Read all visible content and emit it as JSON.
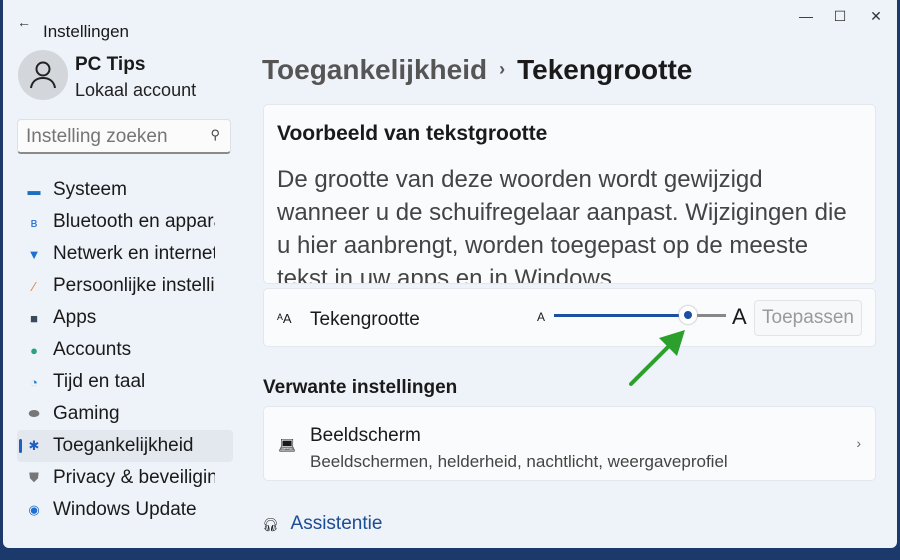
{
  "window": {
    "title": "Instellingen",
    "controls": [
      "minimize",
      "maximize",
      "close"
    ]
  },
  "user": {
    "name": "PC Tips",
    "type": "Lokaal account"
  },
  "search": {
    "placeholder": "Instelling zoeken"
  },
  "sidebar": {
    "items": [
      {
        "label": "Systeem",
        "icon": "monitor-icon",
        "color": "#1e6fc0"
      },
      {
        "label": "Bluetooth en apparaten",
        "icon": "bluetooth-icon",
        "color": "#1f6fd1"
      },
      {
        "label": "Netwerk en internet",
        "icon": "wifi-icon",
        "color": "#1f6fd1"
      },
      {
        "label": "Persoonlijke instellingen",
        "icon": "brush-icon",
        "color": "#e07a30"
      },
      {
        "label": "Apps",
        "icon": "apps-icon",
        "color": "#3a4a5a"
      },
      {
        "label": "Accounts",
        "icon": "person-icon",
        "color": "#2aa37a"
      },
      {
        "label": "Tijd en taal",
        "icon": "globe-clock-icon",
        "color": "#2a7fd0"
      },
      {
        "label": "Gaming",
        "icon": "gamepad-icon",
        "color": "#777777"
      },
      {
        "label": "Toegankelijkheid",
        "icon": "accessibility-icon",
        "color": "#1f5fbf",
        "active": true
      },
      {
        "label": "Privacy & beveiliging",
        "icon": "shield-icon",
        "color": "#777777"
      },
      {
        "label": "Windows Update",
        "icon": "update-icon",
        "color": "#1f6fd1"
      }
    ]
  },
  "breadcrumb": {
    "parent": "Toegankelijkheid",
    "separator": "›",
    "current": "Tekengrootte"
  },
  "preview": {
    "title": "Voorbeeld van tekstgrootte",
    "text": "De grootte van deze woorden wordt gewijzigd wanneer u de schuifregelaar aanpast. Wijzigingen die u hier aanbrengt, worden toegepast op de meeste tekst in uw apps en in Windows."
  },
  "font_size": {
    "label": "Tekengrootte",
    "small_a": "A",
    "big_a": "A",
    "slider_percent": 78,
    "apply_label": "Toepassen"
  },
  "related": {
    "title": "Verwante instellingen",
    "items": [
      {
        "title": "Beeldscherm",
        "subtitle": "Beeldschermen, helderheid, nachtlicht, weergaveprofiel"
      }
    ]
  },
  "help": {
    "label": "Assistentie"
  },
  "colors": {
    "accent": "#1c4fa0",
    "arrow": "#2ca02c"
  }
}
